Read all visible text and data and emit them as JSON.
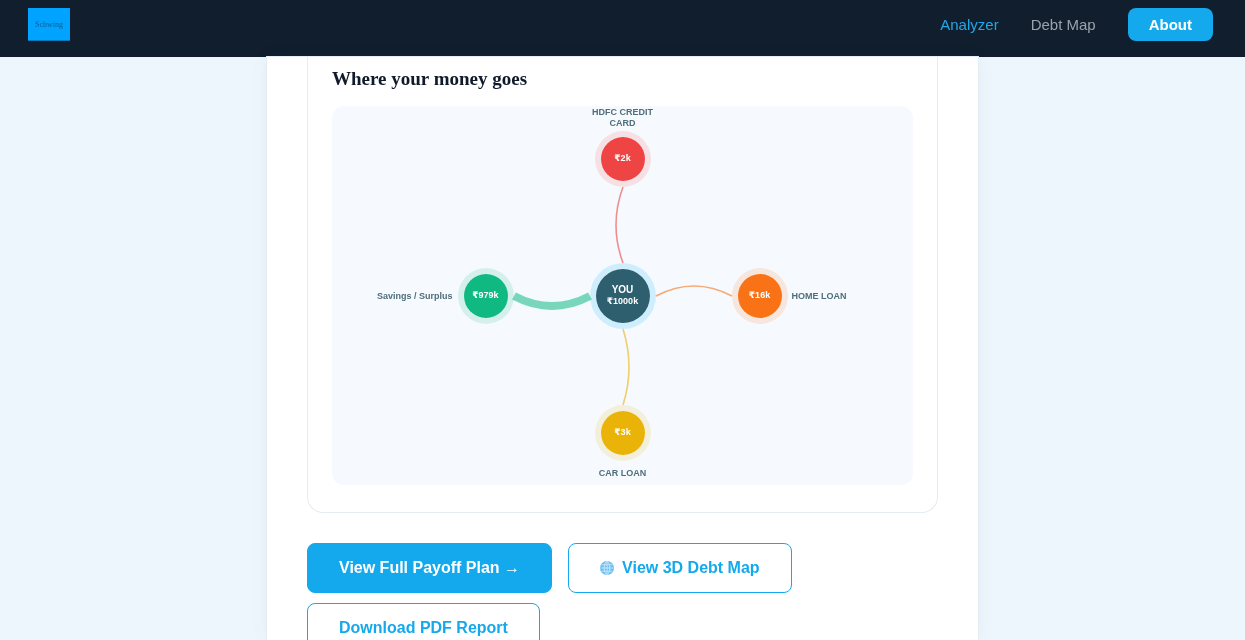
{
  "navbar": {
    "logo": "Schwing",
    "links": [
      {
        "label": "Analyzer",
        "selected": true
      },
      {
        "label": "Debt Map",
        "selected": false
      }
    ],
    "button": "About"
  },
  "money_flow": {
    "title": "Where your money goes",
    "nodes": [
      {
        "kind": "debt",
        "label": "HDFC CREDIT CARD",
        "amount": "₹2k",
        "color": "#ef4444"
      },
      {
        "kind": "surplus",
        "label": "Savings / Surplus",
        "amount": "₹979k",
        "color": "#10b981"
      },
      {
        "kind": "center",
        "label": "YOU",
        "amount": "₹1000k",
        "color": "#2d5f6e"
      },
      {
        "kind": "debt",
        "label": "HOME LOAN",
        "amount": "₹16k",
        "color": "#f97316"
      },
      {
        "kind": "debt",
        "label": "CAR LOAN",
        "amount": "₹3k",
        "color": "#eab308"
      }
    ]
  },
  "actions": [
    {
      "kind": "filled",
      "label": "View Full Payoff Plan →",
      "icon": false
    },
    {
      "kind": "outlined",
      "label": "View 3D Debt Map",
      "icon": true
    },
    {
      "kind": "outlined",
      "label": "Download PDF Report",
      "icon": false
    }
  ]
}
